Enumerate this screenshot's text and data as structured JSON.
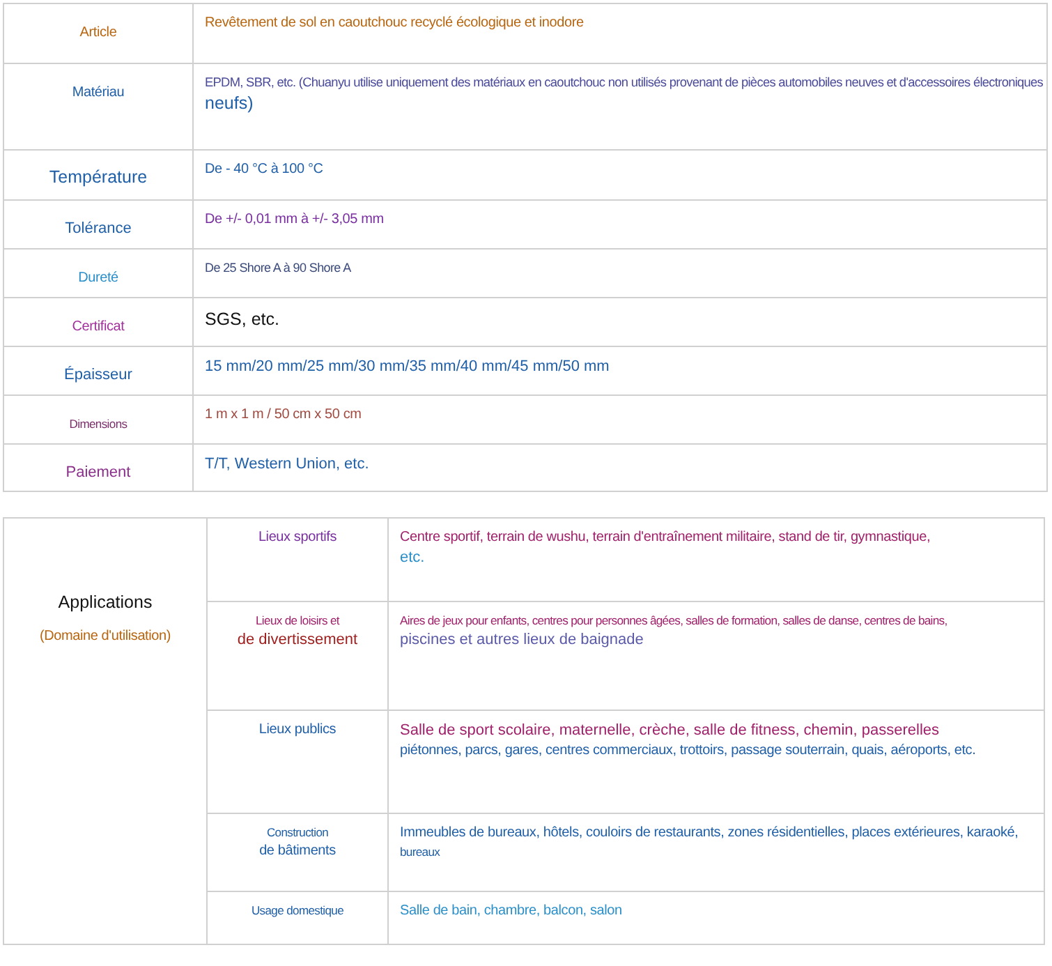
{
  "specs": [
    {
      "label": {
        "text": "Article",
        "color": "#b8650f",
        "kind": "small"
      },
      "value": [
        {
          "text": "Revêtement de sol en caoutchouc recyclé écologique et inodore",
          "color": "#b8650f",
          "kind": "small"
        }
      ]
    },
    {
      "label": {
        "text": "Matériau",
        "color": "#1f5fa8",
        "kind": "small"
      },
      "value": [
        {
          "text": "EPDM, SBR, etc. (Chuanyu utilise uniquement des matériaux en caoutchouc non utilisés provenant de pièces automobiles neuves et d'accessoires électroniques",
          "color": "#4a4a9a",
          "kind": "small"
        },
        {
          "text": "neufs)",
          "color": "#1f5fa8",
          "kind": "large"
        }
      ]
    },
    {
      "label": {
        "text": "Température",
        "color": "#1f5fa8",
        "kind": "large"
      },
      "value": [
        {
          "text": "De - 40 °C à 100 °C",
          "color": "#1f5fa8",
          "kind": "small"
        }
      ]
    },
    {
      "label": {
        "text": "Tolérance",
        "color": "#1f5fa8",
        "kind": "normal"
      },
      "value": [
        {
          "text": "De +/- 0,01 mm à +/- 3,05 mm",
          "color": "#7a2fa0",
          "kind": "small"
        }
      ]
    },
    {
      "label": {
        "text": "Dureté",
        "color": "#2a8fc9",
        "kind": "small"
      },
      "value": [
        {
          "text": "De 25 Shore A à 90 Shore A",
          "color": "#3a4a7a",
          "kind": "tiny"
        }
      ]
    },
    {
      "label": {
        "text": "Certificat",
        "color": "#a0309a",
        "kind": "small"
      },
      "value": [
        {
          "text": "SGS, etc.",
          "color": "#111111",
          "kind": "large"
        }
      ]
    },
    {
      "label": {
        "text": "Épaisseur",
        "color": "#1f5fa8",
        "kind": "normal"
      },
      "value": [
        {
          "text": "15 mm/20 mm/25 mm/30 mm/35 mm/40 mm/45 mm/50 mm",
          "color": "#1f5fa8",
          "kind": "normal"
        }
      ]
    },
    {
      "label": {
        "text": "Dimensions",
        "color": "#7a2f6a",
        "kind": "tiny"
      },
      "value": [
        {
          "text": "1 m x 1 m / 50 cm x 50 cm",
          "color": "#a04a40",
          "kind": "small"
        }
      ]
    },
    {
      "label": {
        "text": "Paiement",
        "color": "#8a2f8a",
        "kind": "normal"
      },
      "value": [
        {
          "text": "T/T, Western Union, etc.",
          "color": "#1f5fa8",
          "kind": "normal"
        }
      ]
    }
  ],
  "applications": {
    "title": {
      "text": "Applications",
      "color": "#111111",
      "kind": "large"
    },
    "subtitle": {
      "text": "(Domaine d'utilisation)",
      "color": "#b8650f",
      "kind": "small"
    },
    "rows": [
      {
        "label": [
          {
            "text": "Lieux sportifs",
            "color": "#7a2fa0",
            "kind": "small"
          }
        ],
        "value": [
          {
            "text": "Centre sportif, terrain de wushu, terrain d'entraînement militaire, stand de tir, gymnastique,",
            "color": "#a0206a",
            "kind": "small"
          },
          {
            "text": "etc.",
            "color": "#2a8fc9",
            "kind": "normal"
          }
        ]
      },
      {
        "label": [
          {
            "text": "Lieux de loisirs et",
            "color": "#a0206a",
            "kind": "tiny"
          },
          {
            "text": "de divertissement",
            "color": "#a02020",
            "kind": "normal"
          }
        ],
        "value": [
          {
            "text": "Aires de jeux pour enfants, centres pour personnes âgées, salles de formation, salles de danse, centres de bains,",
            "color": "#a0206a",
            "kind": "tiny"
          },
          {
            "text": "piscines et autres lieux de baignade",
            "color": "#5a5aa8",
            "kind": "normal"
          }
        ]
      },
      {
        "label": [
          {
            "text": "Lieux publics",
            "color": "#1f5fa8",
            "kind": "small"
          }
        ],
        "value": [
          {
            "text": "Salle de sport scolaire, maternelle, crèche, salle de fitness, chemin, passerelles",
            "color": "#a0206a",
            "kind": "normal"
          },
          {
            "text": "piétonnes, parcs, gares, centres commerciaux, trottoirs, passage souterrain, quais, aéroports, etc.",
            "color": "#1f5fa8",
            "kind": "small"
          }
        ]
      },
      {
        "label": [
          {
            "text": "Construction",
            "color": "#1f5fa8",
            "kind": "tiny"
          },
          {
            "text": "de bâtiments",
            "color": "#1f5fa8",
            "kind": "small"
          }
        ],
        "value": [
          {
            "text": "Immeubles de bureaux, hôtels, couloirs de restaurants, zones résidentielles, places extérieures, karaoké,",
            "color": "#1f5fa8",
            "kind": "small"
          },
          {
            "text": "bureaux",
            "color": "#1f5fa8",
            "kind": "tiny"
          }
        ]
      },
      {
        "label": [
          {
            "text": "Usage domestique",
            "color": "#1f5fa8",
            "kind": "tiny"
          }
        ],
        "value": [
          {
            "text": "Salle de bain, chambre, balcon, salon",
            "color": "#2a8fc9",
            "kind": "small"
          }
        ]
      }
    ]
  }
}
